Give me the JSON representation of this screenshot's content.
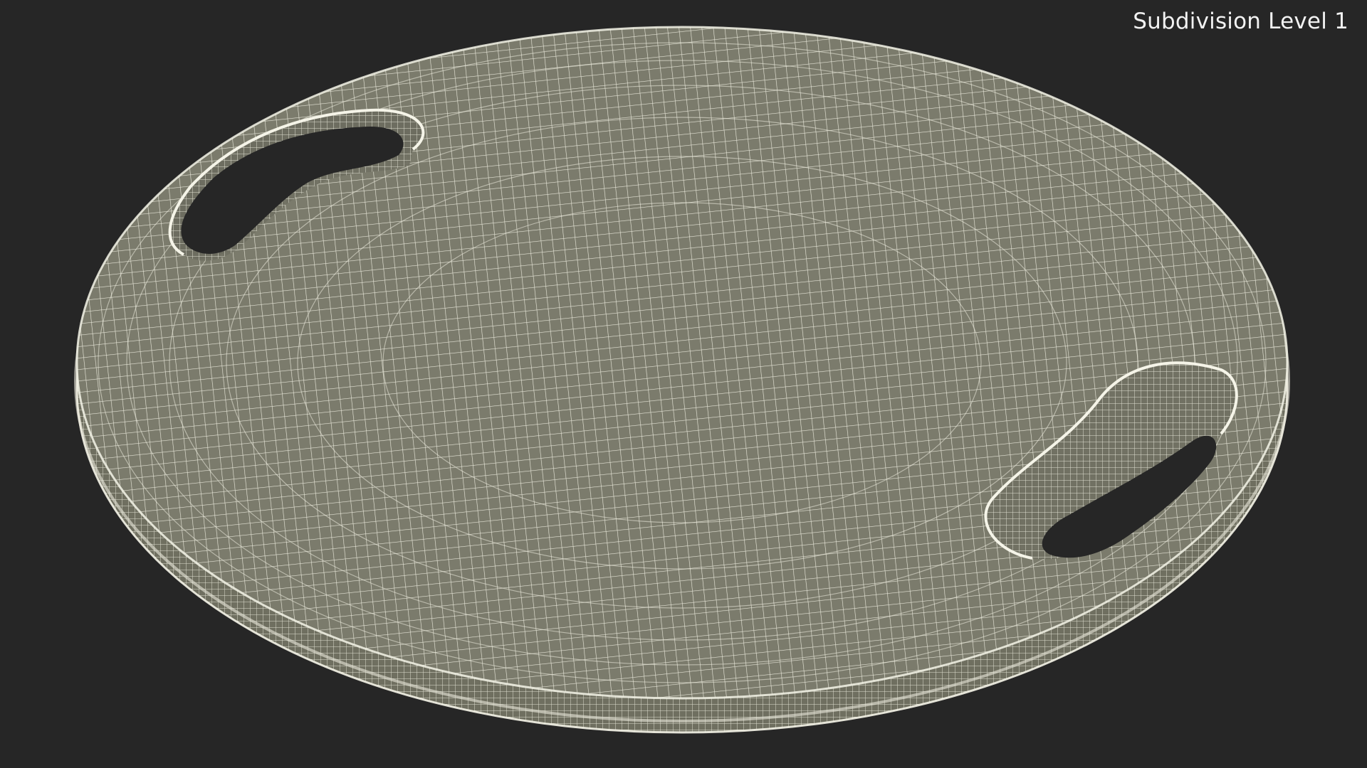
{
  "viewport": {
    "overlay_label": "Subdivision Level 1",
    "background_color": "#262626",
    "mesh_fill_color": "#7b7b6c",
    "wire_color": "#f2f2e6"
  }
}
